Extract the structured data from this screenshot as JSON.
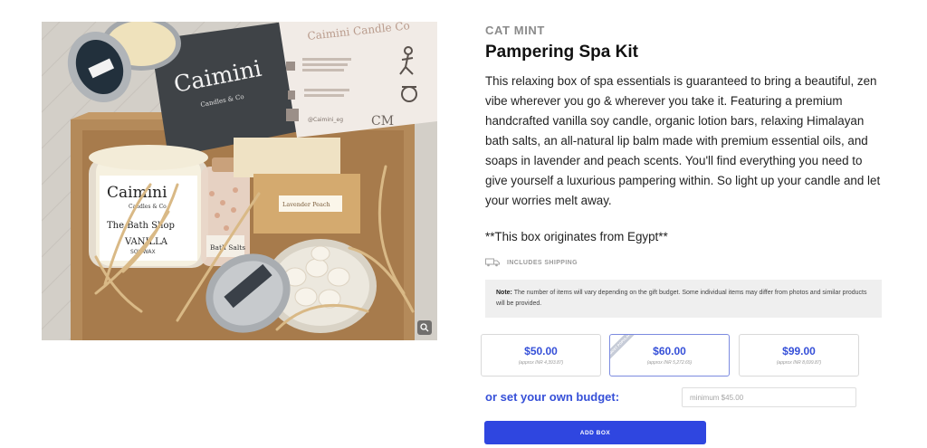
{
  "product": {
    "image_alt": "Pampering Spa Kit",
    "image_text": {
      "card_brand": "Caimini",
      "card_sub": "Candles & Co",
      "candle_brand": "Caimini",
      "candle_sub": "Candles & Co",
      "candle_line": "The Bath Shop",
      "candle_scent": "VANILLA",
      "candle_wax": "SOY WAX",
      "salts": "Bath Salts",
      "soap": "Lavender Peach",
      "insert_title": "Caimini Candle Co",
      "insert_handle": "@Caimini_eg",
      "insert_logo": "CM"
    },
    "zoom_icon": "zoom-icon",
    "brand": "CAT MINT",
    "title": "Pampering Spa Kit",
    "description": "This relaxing box of spa essentials is guaranteed to bring a beautiful, zen vibe wherever you go & wherever you take it. Featuring a premium handcrafted vanilla soy candle, organic lotion bars, relaxing Himalayan bath salts, an all-natural lip balm made with premium essential oils, and soaps in lavender and peach scents. You'll find everything you need to give yourself a luxurious pampering within. So light up your candle and let your worries melt away.",
    "origin": "**This box originates from Egypt**",
    "shipping_icon": "truck-icon",
    "shipping_label": "INCLUDES SHIPPING",
    "note_label": "Note:",
    "note_text": " The number of items will vary depending on the gift budget. Some individual items may differ from photos and similar products will be provided."
  },
  "budgets": [
    {
      "price": "$50.00",
      "approx": "(approx INR 4,393.87)",
      "selected": false
    },
    {
      "price": "$60.00",
      "approx": "(approx INR 5,272.65)",
      "selected": true,
      "ribbon": "MOST POPULAR"
    },
    {
      "price": "$99.00",
      "approx": "(approx INR 8,699.87)",
      "selected": false
    }
  ],
  "own_budget": {
    "label": "or set your own budget:",
    "placeholder": "minimum $45.00",
    "value": ""
  },
  "add_button": "ADD BOX",
  "colors": {
    "accent": "#2f46e0",
    "price": "#3650d8",
    "muted": "#8b8b8b"
  }
}
